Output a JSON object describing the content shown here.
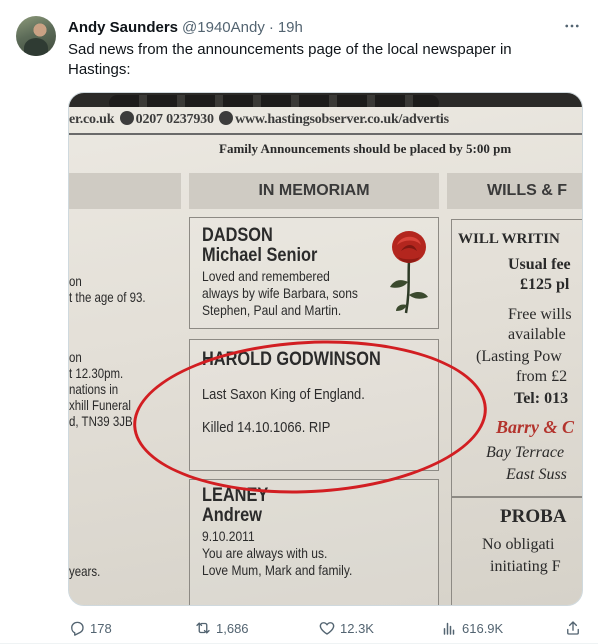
{
  "tweet": {
    "author_name": "Andy Saunders",
    "author_handle": "@1940Andy",
    "separator": "·",
    "time": "19h",
    "text": "Sad news from the announcements page of the local newspaper in Hastings:",
    "more_icon": "more-horizontal-icon"
  },
  "newspaper": {
    "url_left": "er.co.uk",
    "phone": "0207 0237930",
    "url_right": "www.hastingsobserver.co.uk/advertis",
    "family_notice": "Family Announcements should be placed by 5:00 pm",
    "columns": {
      "mid": "IN MEMORIAM",
      "right": "WILLS & F"
    },
    "left_column_fragments": [
      "on",
      "t the age of 93.",
      "on",
      "t 12.30pm.",
      "nations in",
      "xhill Funeral",
      "d, TN39 3JB.",
      "years."
    ],
    "notices": [
      {
        "surname": "DADSON",
        "forename": "Michael Senior",
        "lines": [
          "Loved and remembered",
          "always by wife Barbara, sons",
          "Stephen, Paul and Martin."
        ]
      },
      {
        "surname": "HAROLD GODWINSON",
        "lines": [
          "Last Saxon King of England.",
          "Killed 14.10.1066. RIP"
        ]
      },
      {
        "surname": "LEANEY",
        "forename": "Andrew",
        "lines": [
          "9.10.2011",
          "You are always with us.",
          "Love Mum, Mark and family."
        ]
      }
    ],
    "right_column": {
      "heading": "WILL WRITIN",
      "lines": [
        "Usual fee",
        "£125 pl",
        "Free wills",
        "available",
        "(Lasting Pow",
        "from £2",
        "Tel: 013"
      ],
      "firm": "Barry & C",
      "address": [
        "Bay Terrace",
        "East Suss"
      ],
      "heading2": "PROBA",
      "lines2": [
        "No obligati",
        "initiating F"
      ]
    }
  },
  "actions": {
    "replies": "178",
    "reposts": "1,686",
    "likes": "12.3K",
    "views": "616.9K"
  }
}
